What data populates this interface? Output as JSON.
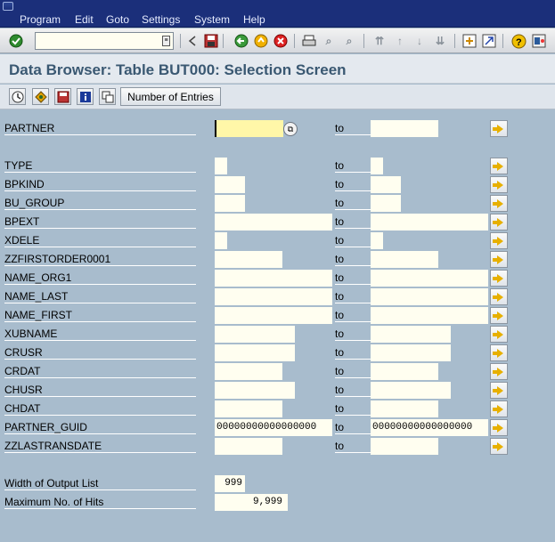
{
  "menu": {
    "items": [
      {
        "label": "Program",
        "key": "P"
      },
      {
        "label": "Edit",
        "key": "E"
      },
      {
        "label": "Goto",
        "key": "G"
      },
      {
        "label": "Settings",
        "key": "S"
      },
      {
        "label": "System",
        "key": "y"
      },
      {
        "label": "Help",
        "key": "H"
      }
    ]
  },
  "toolbar": {
    "command_field_value": "",
    "icons": [
      "enter-icon",
      "back-nav-icon",
      "save-icon",
      "back-icon",
      "exit-icon",
      "cancel-icon",
      "print-icon",
      "find-icon",
      "find-next-icon",
      "first-page-icon",
      "previous-page-icon",
      "next-page-icon",
      "last-page-icon",
      "create-session-icon",
      "shortcut-icon",
      "help-icon",
      "layout-icon"
    ]
  },
  "title": "Data Browser: Table BUT000: Selection Screen",
  "app_toolbar": {
    "number_of_entries_label": "Number of Entries"
  },
  "fields": [
    {
      "label": "PARTNER",
      "low": "",
      "high": "",
      "to": "to"
    },
    {
      "label": "TYPE",
      "low": "",
      "high": "",
      "to": "to"
    },
    {
      "label": "BPKIND",
      "low": "",
      "high": "",
      "to": "to"
    },
    {
      "label": "BU_GROUP",
      "low": "",
      "high": "",
      "to": "to"
    },
    {
      "label": "BPEXT",
      "low": "",
      "high": "",
      "to": "to"
    },
    {
      "label": "XDELE",
      "low": "",
      "high": "",
      "to": "to"
    },
    {
      "label": "ZZFIRSTORDER0001",
      "low": "",
      "high": "",
      "to": "to"
    },
    {
      "label": "NAME_ORG1",
      "low": "",
      "high": "",
      "to": "to"
    },
    {
      "label": "NAME_LAST",
      "low": "",
      "high": "",
      "to": "to"
    },
    {
      "label": "NAME_FIRST",
      "low": "",
      "high": "",
      "to": "to"
    },
    {
      "label": "XUBNAME",
      "low": "",
      "high": "",
      "to": "to"
    },
    {
      "label": "CRUSR",
      "low": "",
      "high": "",
      "to": "to"
    },
    {
      "label": "CRDAT",
      "low": "",
      "high": "",
      "to": "to"
    },
    {
      "label": "CHUSR",
      "low": "",
      "high": "",
      "to": "to"
    },
    {
      "label": "CHDAT",
      "low": "",
      "high": "",
      "to": "to"
    },
    {
      "label": "PARTNER_GUID",
      "low": "00000000000000000",
      "high": "00000000000000000",
      "to": "to"
    },
    {
      "label": "ZZLASTRANSDATE",
      "low": "",
      "high": "",
      "to": "to"
    }
  ],
  "output": {
    "width_label": "Width of Output List",
    "width_value": "999",
    "max_hits_label": "Maximum No. of Hits",
    "max_hits_value": "9,999"
  },
  "colors": {
    "background": "#a8bccd",
    "menubar": "#1b2f7a",
    "title_text": "#3a5872",
    "input_bg": "#fffef0",
    "focus_input_bg": "#fff7a8"
  }
}
